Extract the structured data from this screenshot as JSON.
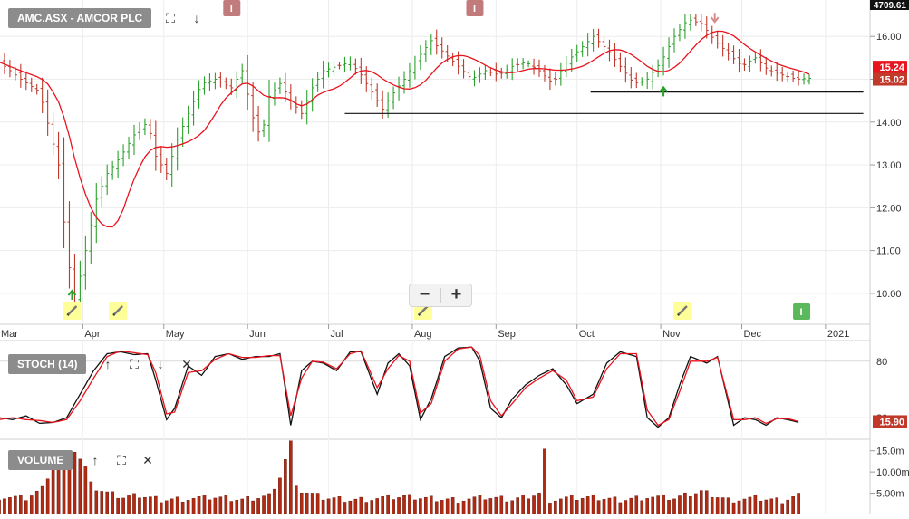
{
  "header": {
    "title": "AMC.ASX - AMCOR PLC",
    "stoch_label": "STOCH (14)",
    "volume_label": "VOLUME",
    "index_value": "4709.61",
    "price_current": "15.02",
    "price_ma": "15.24",
    "stoch_current": "15.90"
  },
  "controls": {
    "zoom_out": "−",
    "zoom_in": "+"
  },
  "markers": {
    "info_label": "I",
    "info_color": "#c27b7b",
    "info_green_color": "#5cb85c",
    "pencil_bg": "#ffff99"
  },
  "colors": {
    "up": "#2ca02c",
    "down": "#c0392b",
    "ma": "#e8141e",
    "stoch_k": "#111111",
    "stoch_d": "#e8141e",
    "volume": "#b22a12"
  },
  "chart_data": [
    {
      "type": "line",
      "title": "AMC.ASX - AMCOR PLC",
      "x_ticks": [
        "Mar",
        "Apr",
        "May",
        "Jun",
        "Jul",
        "Aug",
        "Sep",
        "Oct",
        "Nov",
        "Dec",
        "2021"
      ],
      "y_ticks": [
        "10.00",
        "11.00",
        "12.00",
        "13.00",
        "14.00",
        "15.00",
        "16.00"
      ],
      "ylim": [
        9.3,
        16.85
      ],
      "x_range_days": [
        0,
        300
      ],
      "month_start_days": [
        29,
        60,
        90,
        121,
        151,
        182,
        213,
        243,
        274,
        304,
        335
      ],
      "anchors_close": [
        [
          0,
          15.4
        ],
        [
          8,
          15.0
        ],
        [
          15,
          14.7
        ],
        [
          22,
          13.0
        ],
        [
          25,
          11.0
        ],
        [
          28,
          9.8
        ],
        [
          32,
          11.0
        ],
        [
          36,
          12.2
        ],
        [
          40,
          12.8
        ],
        [
          45,
          13.2
        ],
        [
          50,
          13.7
        ],
        [
          55,
          14.0
        ],
        [
          58,
          13.2
        ],
        [
          62,
          12.8
        ],
        [
          66,
          13.6
        ],
        [
          70,
          14.2
        ],
        [
          75,
          14.9
        ],
        [
          80,
          15.0
        ],
        [
          86,
          14.8
        ],
        [
          90,
          15.2
        ],
        [
          94,
          14.1
        ],
        [
          97,
          13.6
        ],
        [
          100,
          14.6
        ],
        [
          104,
          14.9
        ],
        [
          108,
          14.5
        ],
        [
          112,
          14.2
        ],
        [
          116,
          14.8
        ],
        [
          120,
          15.2
        ],
        [
          125,
          15.3
        ],
        [
          130,
          15.4
        ],
        [
          134,
          15.1
        ],
        [
          138,
          14.7
        ],
        [
          142,
          14.3
        ],
        [
          145,
          14.6
        ],
        [
          150,
          15.0
        ],
        [
          155,
          15.5
        ],
        [
          160,
          15.9
        ],
        [
          165,
          15.6
        ],
        [
          170,
          15.3
        ],
        [
          175,
          15.0
        ],
        [
          180,
          15.2
        ],
        [
          185,
          15.1
        ],
        [
          190,
          15.3
        ],
        [
          195,
          15.4
        ],
        [
          200,
          15.2
        ],
        [
          205,
          14.9
        ],
        [
          210,
          15.4
        ],
        [
          215,
          15.7
        ],
        [
          220,
          16.0
        ],
        [
          225,
          15.7
        ],
        [
          230,
          15.3
        ],
        [
          235,
          14.9
        ],
        [
          240,
          15.0
        ],
        [
          245,
          15.4
        ],
        [
          250,
          16.0
        ],
        [
          255,
          16.4
        ],
        [
          260,
          16.3
        ],
        [
          265,
          15.9
        ],
        [
          270,
          15.6
        ],
        [
          275,
          15.3
        ],
        [
          280,
          15.5
        ],
        [
          285,
          15.2
        ],
        [
          290,
          15.1
        ],
        [
          295,
          15.0
        ],
        [
          300,
          15.02
        ]
      ],
      "candle_every_days": 2,
      "moving_average": {
        "name": "",
        "period_days": 20
      },
      "current_price": 15.02,
      "ma_value": 15.24,
      "horizontal_lines": [
        {
          "y": 14.7,
          "x_from_day": 219,
          "x_to_day": 320
        },
        {
          "y": 14.2,
          "x_from_day": 128,
          "x_to_day": 320
        }
      ],
      "arrows": [
        {
          "day": 27,
          "price": 9.85,
          "dir": "up",
          "color": "#2ca02c"
        },
        {
          "day": 246,
          "price": 14.6,
          "dir": "up",
          "color": "#2ca02c"
        },
        {
          "day": 265,
          "price": 16.55,
          "dir": "down",
          "color": "#d98b8b"
        }
      ],
      "info_markers": [
        {
          "day": 86,
          "pos": "top",
          "color": "#c27b7b"
        },
        {
          "day": 176,
          "pos": "top",
          "color": "#c27b7b"
        },
        {
          "day": 297,
          "pos": "bottom",
          "color": "#5cb85c"
        }
      ],
      "pencil_markers": [
        27,
        44,
        157,
        253
      ]
    },
    {
      "type": "line",
      "title": "STOCH (14)",
      "y_ticks": [
        "80",
        "20"
      ],
      "ylim": [
        0,
        100
      ],
      "series": [
        {
          "name": "",
          "role": "k",
          "anchors": [
            [
              0,
              20
            ],
            [
              5,
              18
            ],
            [
              10,
              22
            ],
            [
              15,
              14
            ],
            [
              20,
              15
            ],
            [
              25,
              20
            ],
            [
              30,
              45
            ],
            [
              35,
              70
            ],
            [
              40,
              88
            ],
            [
              45,
              90
            ],
            [
              50,
              87
            ],
            [
              55,
              88
            ],
            [
              58,
              60
            ],
            [
              62,
              18
            ],
            [
              65,
              30
            ],
            [
              70,
              75
            ],
            [
              75,
              65
            ],
            [
              80,
              85
            ],
            [
              85,
              88
            ],
            [
              90,
              82
            ],
            [
              95,
              85
            ],
            [
              100,
              85
            ],
            [
              104,
              88
            ],
            [
              108,
              12
            ],
            [
              112,
              70
            ],
            [
              116,
              80
            ],
            [
              120,
              78
            ],
            [
              125,
              70
            ],
            [
              130,
              90
            ],
            [
              134,
              90
            ],
            [
              140,
              45
            ],
            [
              144,
              78
            ],
            [
              148,
              88
            ],
            [
              152,
              75
            ],
            [
              156,
              18
            ],
            [
              160,
              40
            ],
            [
              165,
              85
            ],
            [
              170,
              94
            ],
            [
              175,
              95
            ],
            [
              178,
              80
            ],
            [
              182,
              30
            ],
            [
              186,
              20
            ],
            [
              190,
              40
            ],
            [
              195,
              55
            ],
            [
              200,
              65
            ],
            [
              205,
              72
            ],
            [
              210,
              55
            ],
            [
              214,
              35
            ],
            [
              220,
              45
            ],
            [
              225,
              78
            ],
            [
              230,
              90
            ],
            [
              236,
              85
            ],
            [
              240,
              20
            ],
            [
              244,
              10
            ],
            [
              248,
              20
            ],
            [
              252,
              55
            ],
            [
              256,
              85
            ],
            [
              262,
              78
            ],
            [
              266,
              85
            ],
            [
              272,
              12
            ],
            [
              276,
              20
            ],
            [
              280,
              18
            ],
            [
              284,
              12
            ],
            [
              288,
              20
            ],
            [
              292,
              18
            ],
            [
              296,
              15
            ]
          ]
        },
        {
          "name": "",
          "role": "d",
          "anchors": [
            [
              0,
              18
            ],
            [
              5,
              20
            ],
            [
              10,
              18
            ],
            [
              15,
              17
            ],
            [
              20,
              15
            ],
            [
              25,
              18
            ],
            [
              30,
              38
            ],
            [
              35,
              62
            ],
            [
              40,
              85
            ],
            [
              45,
              91
            ],
            [
              50,
              89
            ],
            [
              55,
              87
            ],
            [
              58,
              68
            ],
            [
              62,
              24
            ],
            [
              65,
              26
            ],
            [
              70,
              68
            ],
            [
              75,
              70
            ],
            [
              80,
              82
            ],
            [
              85,
              88
            ],
            [
              90,
              84
            ],
            [
              95,
              84
            ],
            [
              100,
              86
            ],
            [
              104,
              86
            ],
            [
              108,
              22
            ],
            [
              112,
              62
            ],
            [
              116,
              80
            ],
            [
              120,
              79
            ],
            [
              125,
              72
            ],
            [
              130,
              88
            ],
            [
              134,
              91
            ],
            [
              140,
              52
            ],
            [
              144,
              72
            ],
            [
              148,
              86
            ],
            [
              152,
              80
            ],
            [
              156,
              25
            ],
            [
              160,
              35
            ],
            [
              165,
              80
            ],
            [
              170,
              93
            ],
            [
              175,
              95
            ],
            [
              178,
              86
            ],
            [
              182,
              38
            ],
            [
              186,
              22
            ],
            [
              190,
              35
            ],
            [
              195,
              52
            ],
            [
              200,
              62
            ],
            [
              205,
              70
            ],
            [
              210,
              60
            ],
            [
              214,
              38
            ],
            [
              220,
              42
            ],
            [
              225,
              72
            ],
            [
              230,
              88
            ],
            [
              236,
              88
            ],
            [
              240,
              28
            ],
            [
              244,
              12
            ],
            [
              248,
              18
            ],
            [
              252,
              48
            ],
            [
              256,
              80
            ],
            [
              262,
              80
            ],
            [
              266,
              84
            ],
            [
              272,
              18
            ],
            [
              276,
              18
            ],
            [
              280,
              20
            ],
            [
              284,
              14
            ],
            [
              288,
              19
            ],
            [
              292,
              19
            ],
            [
              296,
              16
            ]
          ]
        }
      ],
      "current_value": 15.9
    },
    {
      "type": "bar",
      "title": "VOLUME",
      "y_ticks": [
        "5.00m",
        "10.00m",
        "15.0m"
      ],
      "ylim": [
        0,
        17.5
      ],
      "bar_every_days": 2,
      "anchors": [
        [
          0,
          4.2
        ],
        [
          10,
          3.8
        ],
        [
          16,
          6.0
        ],
        [
          20,
          12.0
        ],
        [
          25,
          14.0
        ],
        [
          28,
          15.0
        ],
        [
          32,
          11.0
        ],
        [
          36,
          6.0
        ],
        [
          40,
          5.0
        ],
        [
          46,
          4.0
        ],
        [
          52,
          4.5
        ],
        [
          60,
          3.5
        ],
        [
          70,
          3.8
        ],
        [
          80,
          4.0
        ],
        [
          90,
          3.5
        ],
        [
          100,
          4.5
        ],
        [
          104,
          9.0
        ],
        [
          106,
          13.0
        ],
        [
          108,
          17.0
        ],
        [
          110,
          6.0
        ],
        [
          120,
          4.0
        ],
        [
          130,
          3.5
        ],
        [
          140,
          3.8
        ],
        [
          150,
          4.2
        ],
        [
          160,
          3.8
        ],
        [
          170,
          3.5
        ],
        [
          180,
          4.0
        ],
        [
          190,
          3.5
        ],
        [
          200,
          5.0
        ],
        [
          202,
          15.0
        ],
        [
          204,
          3.5
        ],
        [
          210,
          3.8
        ],
        [
          220,
          4.0
        ],
        [
          230,
          3.5
        ],
        [
          240,
          4.2
        ],
        [
          250,
          3.8
        ],
        [
          260,
          5.5
        ],
        [
          270,
          3.5
        ],
        [
          280,
          3.8
        ],
        [
          290,
          3.2
        ],
        [
          296,
          4.5
        ]
      ]
    }
  ]
}
